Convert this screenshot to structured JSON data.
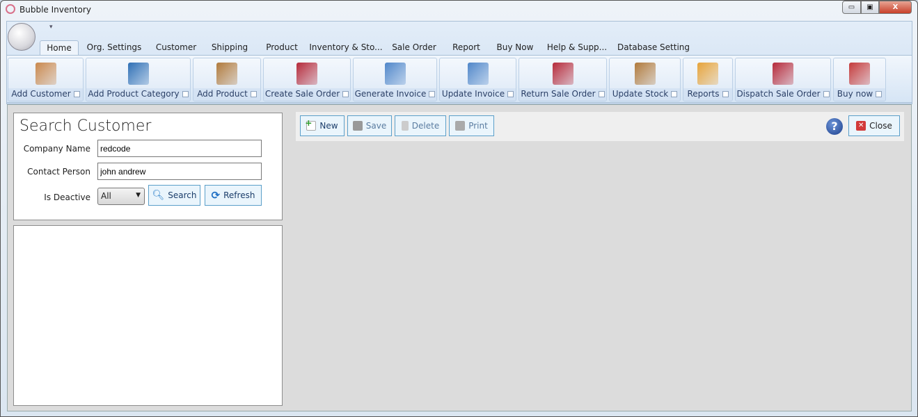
{
  "window": {
    "title": "Bubble Inventory",
    "minimize": "▭",
    "maximize": "▣",
    "close": "X"
  },
  "quick_access": "▾",
  "tabs": [
    {
      "label": "Home",
      "active": true
    },
    {
      "label": "Org. Settings"
    },
    {
      "label": "Customer"
    },
    {
      "label": "Shipping"
    },
    {
      "label": "Product"
    },
    {
      "label": "Inventory & Sto..."
    },
    {
      "label": "Sale Order"
    },
    {
      "label": "Report"
    },
    {
      "label": "Buy Now"
    },
    {
      "label": "Help & Supp..."
    },
    {
      "label": "Database Setting"
    }
  ],
  "ribbon": [
    {
      "label": "Add Customer",
      "icon": "user-add-icon",
      "color": "#c9884d"
    },
    {
      "label": "Add Product Category",
      "icon": "category-add-icon",
      "color": "#2e6fb5"
    },
    {
      "label": "Add Product",
      "icon": "box-add-icon",
      "color": "#b07a3c"
    },
    {
      "label": "Create Sale Order",
      "icon": "sale-order-icon",
      "color": "#b52a3a"
    },
    {
      "label": "Generate Invoice",
      "icon": "invoice-add-icon",
      "color": "#4f86c9"
    },
    {
      "label": "Update Invoice",
      "icon": "invoice-edit-icon",
      "color": "#4f86c9"
    },
    {
      "label": "Return Sale Order",
      "icon": "sale-order-return-icon",
      "color": "#b52a3a"
    },
    {
      "label": "Update Stock",
      "icon": "stock-edit-icon",
      "color": "#b07a3c"
    },
    {
      "label": "Reports",
      "icon": "bar-chart-icon",
      "color": "#e6a33a"
    },
    {
      "label": "Dispatch Sale Order",
      "icon": "sale-order-dispatch-icon",
      "color": "#b52a3a"
    },
    {
      "label": "Buy now",
      "icon": "cart-icon",
      "color": "#c43a3a"
    }
  ],
  "search": {
    "title": "Search Customer",
    "company_label": "Company Name",
    "company_value": "redcode",
    "contact_label": "Contact Person",
    "contact_value": "john andrew",
    "deactive_label": "Is Deactive",
    "deactive_value": "All",
    "search_btn": "Search",
    "refresh_btn": "Refresh"
  },
  "toolbar": {
    "new": "New",
    "save": "Save",
    "delete": "Delete",
    "print": "Print",
    "help": "?",
    "close": "Close"
  }
}
